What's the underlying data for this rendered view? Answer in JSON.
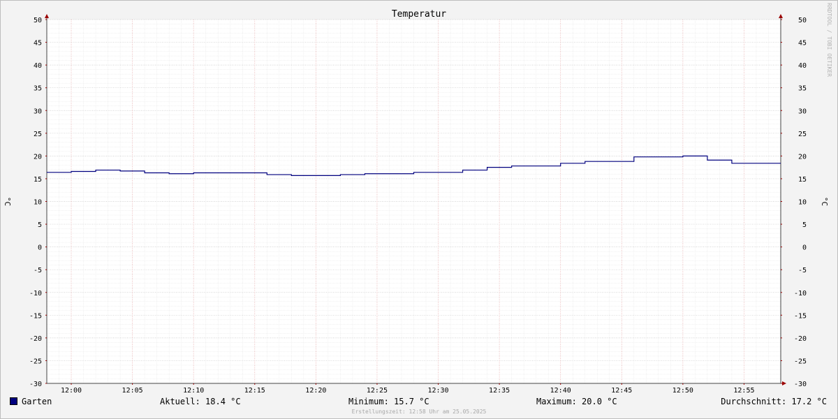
{
  "chart_data": {
    "type": "line",
    "title": "Temperatur",
    "ylabel": "°C",
    "ylim": [
      -30,
      50
    ],
    "yticks": [
      50,
      45,
      40,
      35,
      30,
      25,
      20,
      15,
      10,
      5,
      0,
      -5,
      -10,
      -15,
      -20,
      -25,
      -30
    ],
    "x_range_minutes": [
      "11:58",
      "12:58"
    ],
    "xticks": [
      "12:00",
      "12:05",
      "12:10",
      "12:15",
      "12:20",
      "12:25",
      "12:30",
      "12:35",
      "12:40",
      "12:45",
      "12:50",
      "12:55"
    ],
    "grid": true,
    "series": [
      {
        "name": "Garten",
        "color": "#00007f",
        "x": [
          "11:58",
          "12:00",
          "12:02",
          "12:04",
          "12:06",
          "12:08",
          "12:10",
          "12:12",
          "12:14",
          "12:16",
          "12:18",
          "12:20",
          "12:22",
          "12:24",
          "12:26",
          "12:28",
          "12:30",
          "12:32",
          "12:34",
          "12:36",
          "12:38",
          "12:40",
          "12:42",
          "12:44",
          "12:46",
          "12:48",
          "12:50",
          "12:52",
          "12:54",
          "12:56",
          "12:58"
        ],
        "values": [
          16.4,
          16.6,
          16.9,
          16.7,
          16.3,
          16.1,
          16.3,
          16.3,
          16.3,
          15.9,
          15.7,
          15.7,
          15.9,
          16.1,
          16.1,
          16.4,
          16.4,
          16.9,
          17.5,
          17.8,
          17.8,
          18.4,
          18.8,
          18.8,
          19.8,
          19.8,
          20.0,
          19.1,
          18.4,
          18.4,
          18.4
        ]
      }
    ]
  },
  "legend": {
    "series_name": "Garten",
    "series_color": "#00007f",
    "aktuell": "Aktuell: 18.4 °C",
    "minimum": "Minimum: 15.7 °C",
    "maximum": "Maximum: 20.0 °C",
    "durchschnitt": "Durchschnitt: 17.2 °C"
  },
  "footer": "Erstellungszeit: 12:58 Uhr am 25.05.2025",
  "watermark": "RRDTOOL / TOBI OETIKER"
}
